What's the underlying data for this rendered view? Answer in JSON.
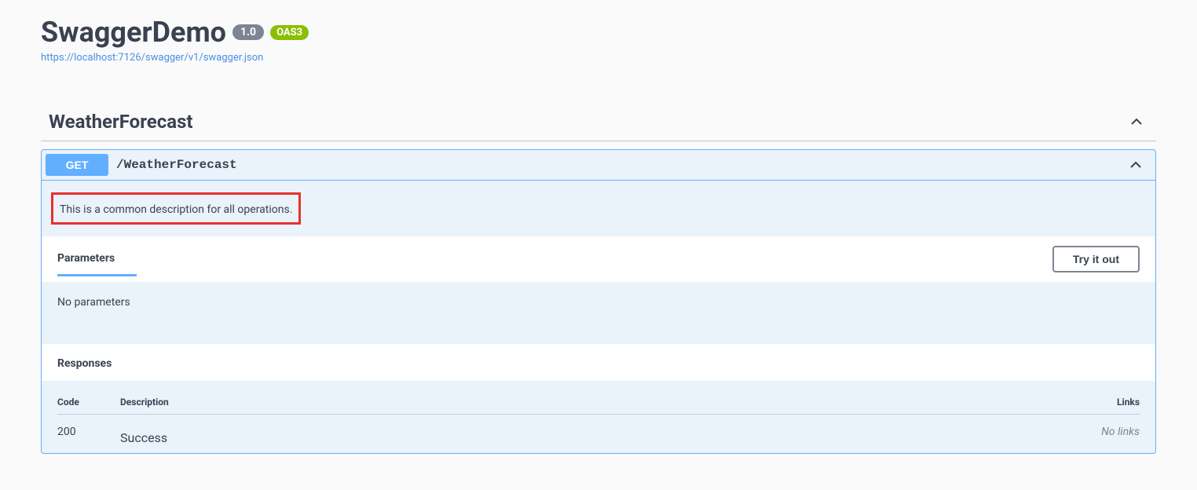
{
  "header": {
    "title": "SwaggerDemo",
    "version": "1.0",
    "oas_version": "OAS3",
    "url": "https://localhost:7126/swagger/v1/swagger.json"
  },
  "tag": {
    "name": "WeatherForecast"
  },
  "operation": {
    "method": "GET",
    "path": "/WeatherForecast",
    "description": "This is a common description for all operations.",
    "parameters_label": "Parameters",
    "try_it_label": "Try it out",
    "no_params_text": "No parameters",
    "responses_label": "Responses",
    "responses_table": {
      "header_code": "Code",
      "header_description": "Description",
      "header_links": "Links",
      "rows": [
        {
          "code": "200",
          "description": "Success",
          "links": "No links"
        }
      ]
    }
  }
}
